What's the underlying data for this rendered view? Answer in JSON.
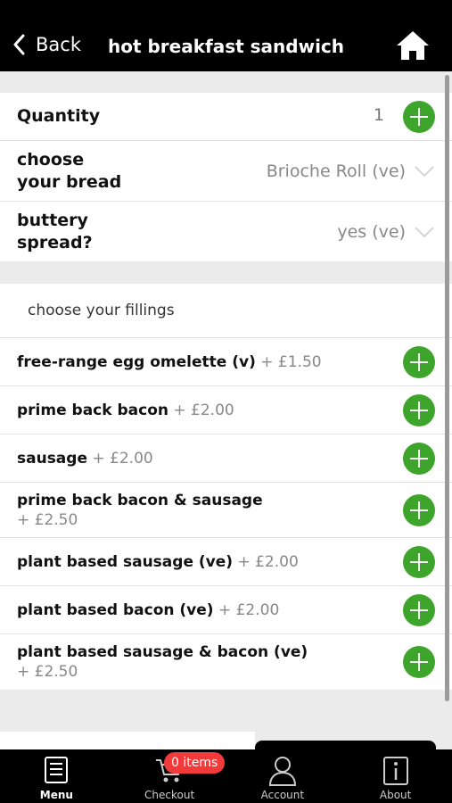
{
  "header": {
    "back_label": "Back",
    "title": "hot breakfast sandwich"
  },
  "options": {
    "quantity_label": "Quantity",
    "quantity_value": "1",
    "bread_label_line1": "choose",
    "bread_label_line2": "your bread",
    "bread_value": "Brioche Roll (ve)",
    "spread_label_line1": "buttery",
    "spread_label_line2": "spread?",
    "spread_value": "yes (ve)"
  },
  "fillings": {
    "heading": "choose your fillings",
    "items": [
      {
        "name": "free-range egg omelette (v)",
        "price": "+ £1.50"
      },
      {
        "name": "prime back bacon",
        "price": "+ £2.00"
      },
      {
        "name": "sausage",
        "price": "+ £2.00"
      },
      {
        "name": "prime back bacon & sausage",
        "price": "+ £2.50"
      },
      {
        "name": "plant based sausage (ve)",
        "price": "+ £2.00"
      },
      {
        "name": "plant based bacon (ve)",
        "price": "+ £2.00"
      },
      {
        "name": "plant based sausage & bacon (ve)",
        "price": "+ £2.50"
      }
    ]
  },
  "tabbar": {
    "menu": "Menu",
    "checkout": "Checkout",
    "account": "Account",
    "about": "About",
    "checkout_badge": "0 items"
  },
  "colors": {
    "accent_green": "#3ea52c",
    "badge_red": "#f23a3a",
    "header_bg": "#000000"
  }
}
